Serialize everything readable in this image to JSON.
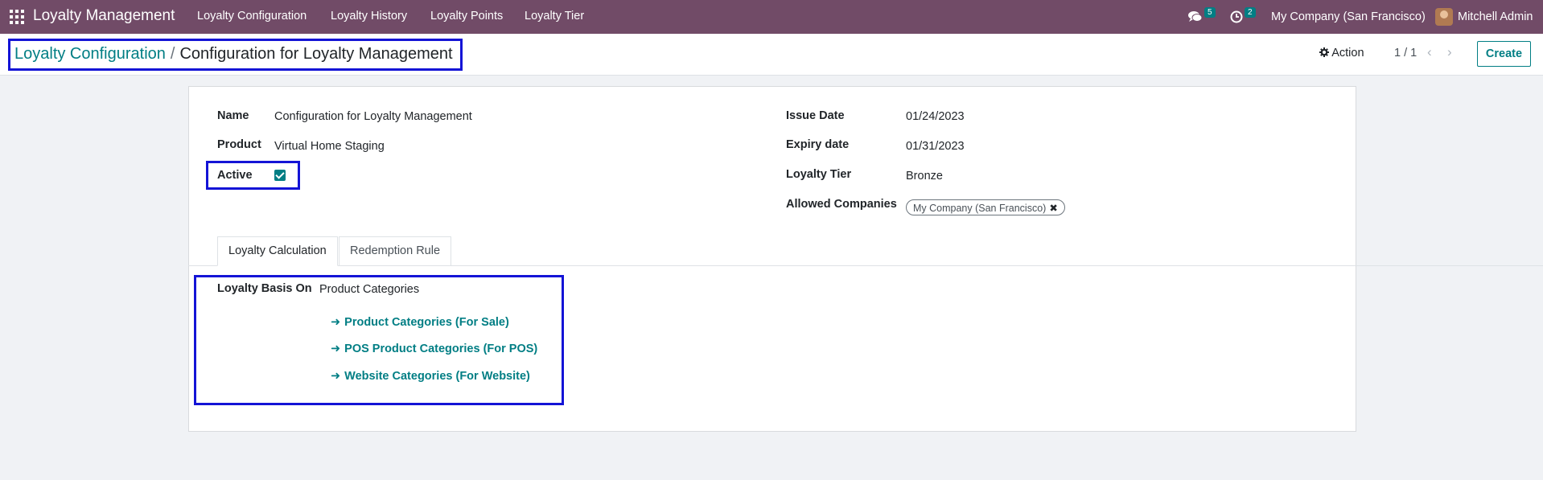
{
  "navbar": {
    "app_name": "Loyalty Management",
    "menu": [
      "Loyalty Configuration",
      "Loyalty History",
      "Loyalty Points",
      "Loyalty Tier"
    ],
    "messages_count": "5",
    "activities_count": "2",
    "company": "My Company (San Francisco)",
    "user": "Mitchell Admin"
  },
  "control": {
    "breadcrumb_parent": "Loyalty Configuration",
    "breadcrumb_separator": "/",
    "breadcrumb_current": "Configuration for Loyalty Management",
    "action_label": "Action",
    "pager": "1 / 1",
    "create_label": "Create"
  },
  "form": {
    "name_label": "Name",
    "name_value": "Configuration for Loyalty Management",
    "product_label": "Product",
    "product_value": "Virtual Home Staging",
    "active_label": "Active",
    "active_checked": true,
    "issue_date_label": "Issue Date",
    "issue_date_value": "01/24/2023",
    "expiry_date_label": "Expiry date",
    "expiry_date_value": "01/31/2023",
    "tier_label": "Loyalty Tier",
    "tier_value": "Bronze",
    "companies_label": "Allowed Companies",
    "companies_tag": "My Company (San Francisco)"
  },
  "tabs": [
    {
      "label": "Loyalty Calculation",
      "active": true
    },
    {
      "label": "Redemption Rule",
      "active": false
    }
  ],
  "calculation": {
    "basis_label": "Loyalty Basis On",
    "basis_value": "Product Categories",
    "links": [
      "Product Categories (For Sale)",
      "POS Product Categories (For POS)",
      "Website Categories (For Website)"
    ]
  },
  "colors": {
    "navbar": "#714b67",
    "accent": "#017e84",
    "highlight_border": "#1414d6"
  }
}
